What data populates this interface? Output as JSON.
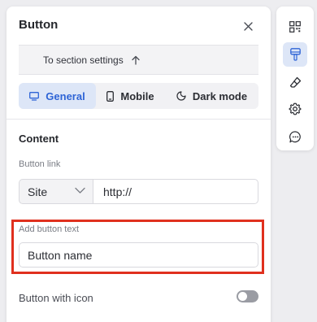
{
  "panel": {
    "title": "Button",
    "section_link": "To section settings"
  },
  "tabs": [
    {
      "label": "General",
      "icon": "desktop-icon",
      "active": true
    },
    {
      "label": "Mobile",
      "icon": "mobile-icon",
      "active": false
    },
    {
      "label": "Dark mode",
      "icon": "moon-icon",
      "active": false
    }
  ],
  "content": {
    "heading": "Content",
    "button_link": {
      "label": "Button link",
      "type_value": "Site",
      "url_value": "http://"
    },
    "button_text": {
      "label": "Add button text",
      "value": "Button name"
    },
    "button_with_icon": {
      "label": "Button with icon",
      "enabled": false
    }
  },
  "toolbar": {
    "items": [
      "qr-code-icon",
      "paint-brush-icon",
      "eraser-icon",
      "settings-gear-icon",
      "chat-bubble-icon"
    ],
    "active_item": "paint-brush-icon"
  },
  "colors": {
    "accent": "#2e64d6",
    "active_tab_bg": "#dde6f7",
    "highlight": "#e0301e"
  }
}
